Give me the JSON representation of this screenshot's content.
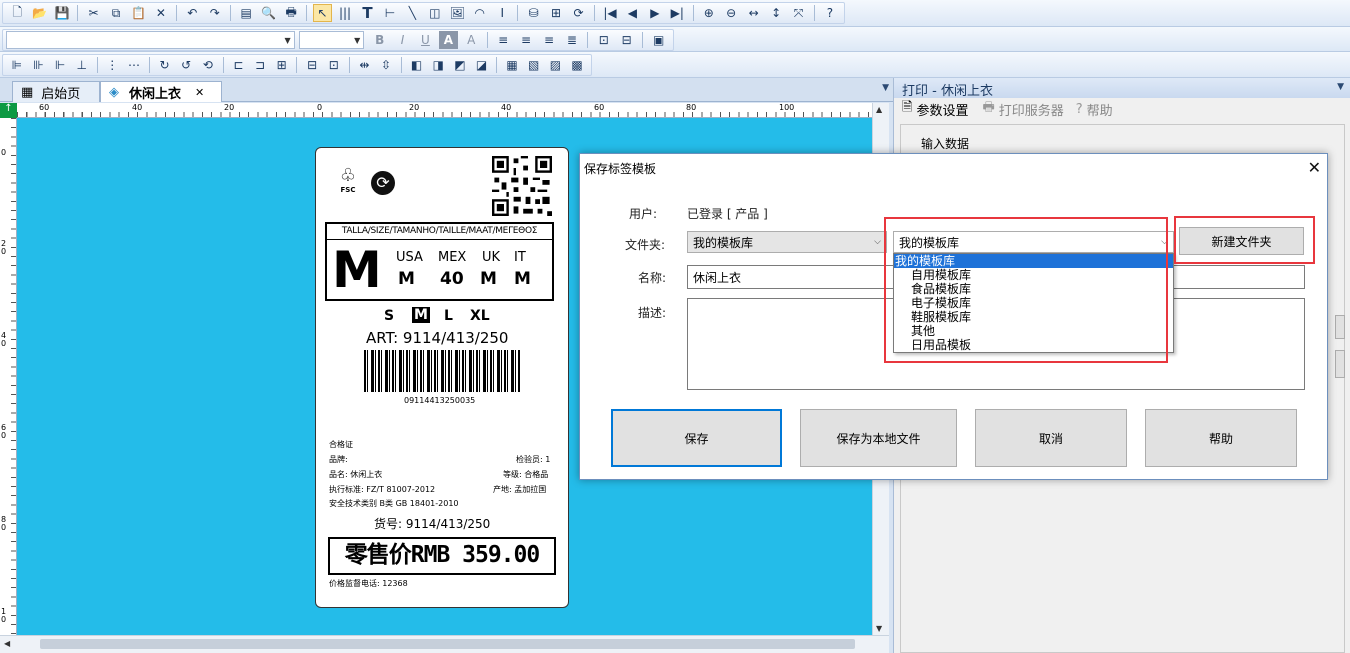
{
  "toolbar_icons": [
    "new-icon",
    "open-icon",
    "save-icon",
    "cut-icon",
    "copy-icon",
    "paste-icon",
    "delete-icon",
    "undo-icon",
    "redo-icon",
    "page-setup-icon",
    "print-preview-icon",
    "print-icon",
    "pointer-icon",
    "barcode-icon",
    "text-icon",
    "line-h-icon",
    "line-icon",
    "shape-icon",
    "image-icon",
    "rfid-icon",
    "cursor-icon",
    "database-icon",
    "db-link-icon",
    "refresh-icon",
    "first-icon",
    "prev-icon",
    "next-icon",
    "last-icon",
    "zoom-in-icon",
    "zoom-out-icon",
    "fit-width-icon",
    "fit-height-icon",
    "fit-page-icon",
    "help-icon"
  ],
  "format_bar": {
    "bold": "B",
    "italic": "I",
    "underline": "U",
    "font_color": "A",
    "highlight": "A"
  },
  "tabs": [
    {
      "label": "启始页"
    },
    {
      "label": "休闲上衣",
      "active": true,
      "close": "✕"
    }
  ],
  "ruler_h": [
    "60",
    "40",
    "20",
    "0",
    "20",
    "40",
    "60",
    "80",
    "100"
  ],
  "ruler_v": [
    "0",
    "2 0",
    "4 0",
    "6 0",
    "8 0",
    "1 0"
  ],
  "label": {
    "fsc": "FSC",
    "size_header": "TALLA/SIZE/TAMANHO/TAILLE/MAAT/ΜΕΓΕΘΟΣ",
    "big_size": "M",
    "regions": [
      "USA",
      "MEX",
      "UK",
      "IT"
    ],
    "region_sizes": [
      "M",
      "40",
      "M",
      "M"
    ],
    "sizes": [
      "S",
      "M",
      "L",
      "XL"
    ],
    "art": "ART:  9114/413/250",
    "barcode_number": "09114413250035",
    "cert_title": "合格证",
    "brand": "品牌:",
    "inspector": "检验员: 1",
    "product_name": "品名: 休闲上衣",
    "grade": "等级: 合格品",
    "standard": "执行标准: FZ/T 81007-2012",
    "origin": "产地: 孟加拉国",
    "safety": "安全技术类别  B类 GB 18401-2010",
    "goods_no": "货号: 9114/413/250",
    "price": "零售价RMB 359.00",
    "hotline": "价格监督电话: 12368"
  },
  "right_panel": {
    "title": "打印 - 休闲上衣",
    "tabs": [
      "参数设置",
      "打印服务器",
      "帮助"
    ],
    "section": "输入数据"
  },
  "dialog": {
    "title": "保存标签模板",
    "close": "✕",
    "user_label": "用户:",
    "user_value": "已登录 [ 产品 ]",
    "folder_label": "文件夹:",
    "folder_value": "我的模板库",
    "folder_value2": "我的模板库",
    "name_label": "名称:",
    "name_value": "休闲上衣",
    "desc_label": "描述:",
    "new_folder": "新建文件夹",
    "folder_options": [
      "我的模板库",
      "自用模板库",
      "食品模板库",
      "电子模板库",
      "鞋服模板库",
      "其他",
      "日用品模板"
    ],
    "buttons": [
      "保存",
      "保存为本地文件",
      "取消",
      "帮助"
    ]
  },
  "colors": {
    "canvas": "#24bce9",
    "highlight": "#e8363d",
    "selected": "#1e72d8"
  }
}
